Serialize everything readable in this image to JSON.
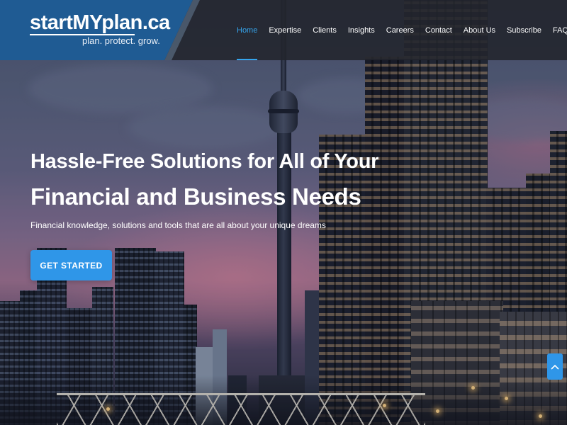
{
  "header": {
    "logo_text": "startMYplan.ca",
    "logo_tagline": "plan. protect. grow.",
    "nav": [
      {
        "label": "Home",
        "active": true
      },
      {
        "label": "Expertise",
        "active": false
      },
      {
        "label": "Clients",
        "active": false
      },
      {
        "label": "Insights",
        "active": false
      },
      {
        "label": "Careers",
        "active": false
      },
      {
        "label": "Contact",
        "active": false
      },
      {
        "label": "About Us",
        "active": false
      },
      {
        "label": "Subscribe",
        "active": false
      },
      {
        "label": "FAQs",
        "active": false
      }
    ]
  },
  "hero": {
    "title_line1": "Hassle-Free Solutions for All of Your",
    "title_line2": "Financial and Business Needs",
    "subtitle": "Financial knowledge, solutions and tools that are all about your unique dreams",
    "cta_label": "GET STARTED"
  },
  "scroll_top_icon": "chevron-up-icon",
  "colors": {
    "brand_blue": "#1f5b93",
    "accent_blue": "#2f96e8",
    "active_nav": "#35a4ec"
  }
}
